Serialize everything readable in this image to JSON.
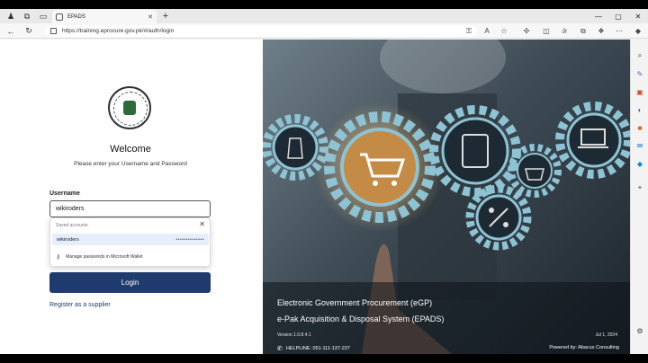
{
  "browser": {
    "tab_title": "EPADS",
    "url": "https://training.eprocure.gov.pk/#/auth/login",
    "new_tab_symbol": "+",
    "tab_close_symbol": "✕",
    "window_controls": [
      "—",
      "▢",
      "✕"
    ]
  },
  "login": {
    "welcome": "Welcome",
    "subtitle": "Please enter your Username and Password",
    "username_label": "Username",
    "username_value": "wikiroders",
    "login_button": "Login",
    "register_link": "Register as a supplier"
  },
  "autofill": {
    "header": "Saved accounts",
    "close_symbol": "✕",
    "account_username": "wikiroders",
    "account_password": "••••••••••••••",
    "manage_text": "Manage passwords in Microsoft Wallet"
  },
  "hero": {
    "title_line1": "Electronic Government Procurement (eGP)",
    "title_line2": "e-Pak Acquisition & Disposal System (EPADS)",
    "version": "Version 1.0.8.4.1",
    "date": "Jul 1, 2024",
    "helpline": "HELPLINE: 051-111-137-237",
    "powered_by": "Powered by: Abacus Consulting"
  },
  "colors": {
    "login_button": "#1f3b6e",
    "gear": "#8ec3d4",
    "hero_dark": "#1c242c"
  },
  "icons": {
    "toolbar": [
      "back-icon",
      "refresh-icon",
      "lock-icon",
      "star-icon",
      "split-icon",
      "favorites-icon",
      "collections-icon",
      "profile-icon",
      "more-icon"
    ],
    "sidebar": [
      "search-icon",
      "tools-icon",
      "office-icon",
      "outlook-icon",
      "bing-icon",
      "add-icon"
    ]
  }
}
